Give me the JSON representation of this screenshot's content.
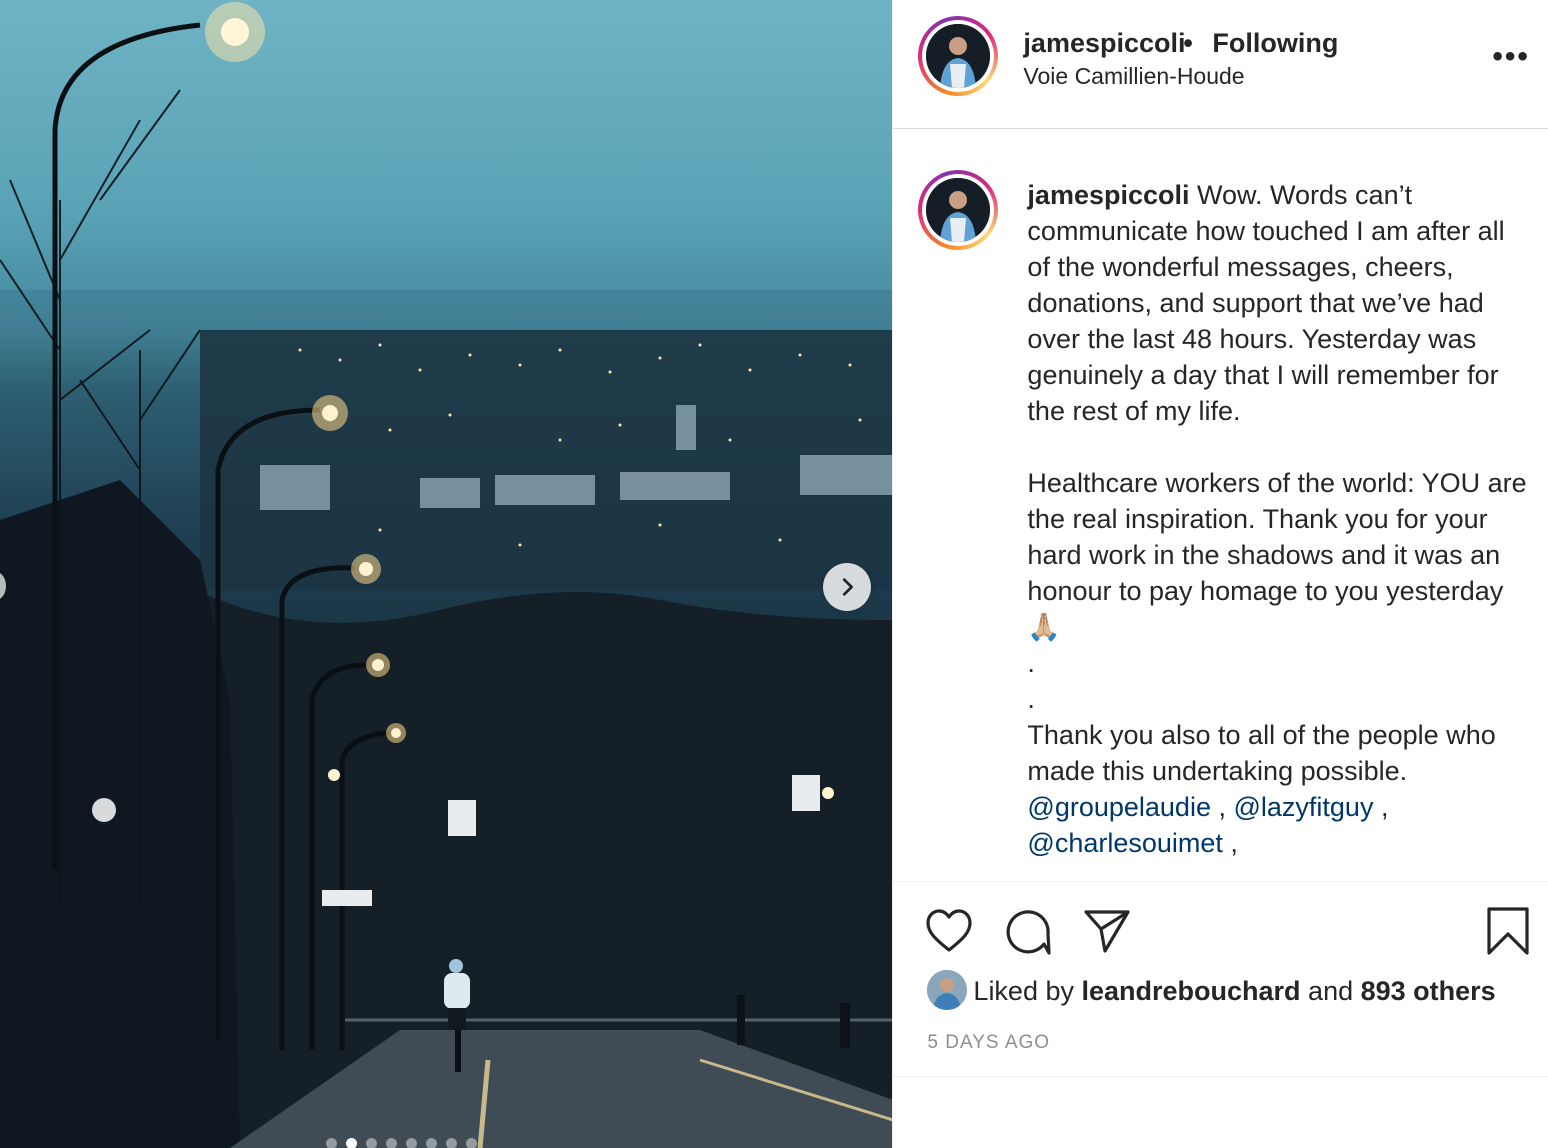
{
  "post": {
    "username": "jamespiccoli",
    "separator": "•",
    "follow_status": "Following",
    "location": "Voie Camillien-Houde",
    "more_label": "•••"
  },
  "caption": {
    "username": "jamespiccoli",
    "text": " Wow. Words can’t communicate how touched I am after all of the wonderful messages, cheers, donations, and support that we’ve had over the last 48 hours. Yesterday was genuinely a day that I will remember for the rest of my life.\n\nHealthcare workers of the world: YOU are the real inspiration. Thank you for your hard work in the shadows and it was an honour to pay homage to you yesterday 🙏🏼\n.\n.\nThank you also to all of the people who made this undertaking possible. ",
    "mentions": [
      "@groupelaudie",
      "@lazyfitguy",
      "@charlesouimet"
    ],
    "separators": [
      " , ",
      " , ",
      " ,"
    ]
  },
  "likes": {
    "prefix": "Liked by ",
    "user": "leandrebouchard",
    "middle": " and ",
    "count_text": "893 others"
  },
  "timestamp": "5 DAYS AGO",
  "carousel": {
    "total": 8,
    "active_index": 1
  },
  "colors": {
    "mention": "#00376b",
    "text": "#262626",
    "muted": "#8e8e8e"
  },
  "icons": [
    "heart-icon",
    "comment-icon",
    "share-icon",
    "bookmark-icon",
    "chevron-right-icon",
    "more-icon"
  ]
}
